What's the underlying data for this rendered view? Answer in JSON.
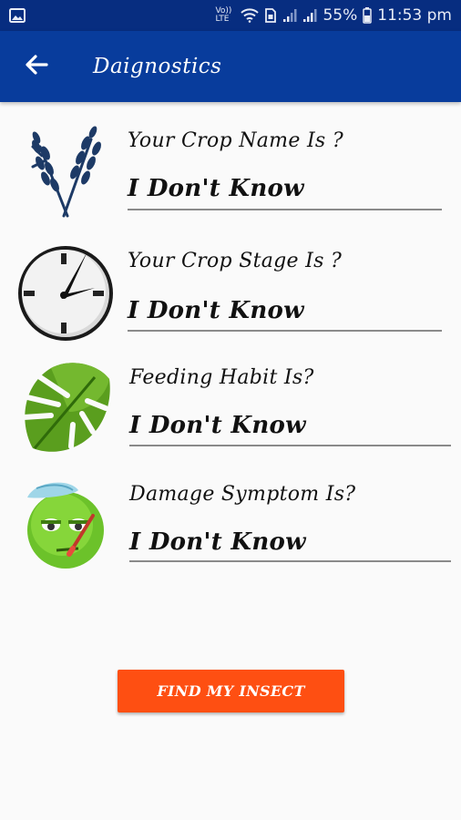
{
  "status_bar": {
    "network_label": "Vo)) LTE",
    "battery_percent": "55%",
    "time": "11:53 pm",
    "icons": [
      "image-icon",
      "wifi-icon",
      "sim-icon",
      "signal-icon",
      "signal-icon",
      "battery-icon"
    ]
  },
  "app_bar": {
    "title": "Daignostics",
    "back_icon": "arrow-left-icon"
  },
  "fields": [
    {
      "icon": "wheat-icon",
      "question": "Your Crop Name Is ?",
      "value": "I Don't Know"
    },
    {
      "icon": "clock-icon",
      "question": "Your Crop Stage Is ?",
      "value": "I Don't Know"
    },
    {
      "icon": "leaf-icon",
      "question": "Feeding Habit Is?",
      "value": "I Don't Know"
    },
    {
      "icon": "sick-face-icon",
      "question": "Damage Symptom Is?",
      "value": "I Don't Know"
    }
  ],
  "button": {
    "label": "FIND MY INSECT",
    "color": "#fe4f12"
  },
  "colors": {
    "status_bar": "#072d80",
    "app_bar": "#083c9c",
    "background": "#fafafa"
  }
}
